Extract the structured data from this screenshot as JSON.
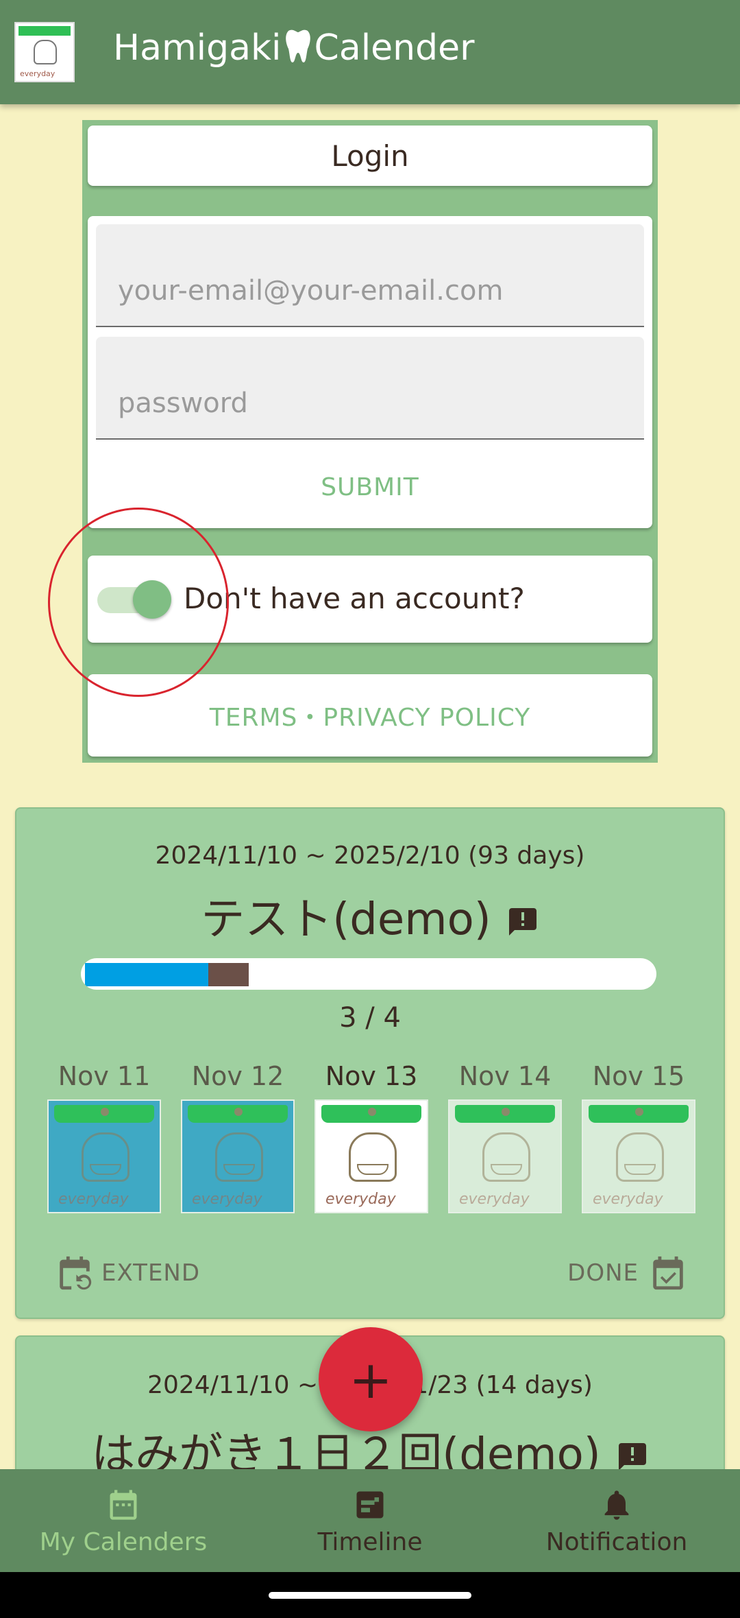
{
  "app": {
    "title_left": "Hamigaki",
    "title_right": "Calender",
    "logo_text": "everyday"
  },
  "login": {
    "title": "Login",
    "email_placeholder": "your-email@your-email.com",
    "password_placeholder": "password",
    "submit_label": "SUBMIT",
    "switch_label": "Don't have an account?",
    "switch_on": true,
    "terms_label": "TERMS・PRIVACY POLICY"
  },
  "calendars": [
    {
      "date_range": "2024/11/10 ~ 2025/2/10 (93 days)",
      "title": "テスト(demo)",
      "progress_text": "3 / 4",
      "progress": {
        "done": 3,
        "total": 4
      },
      "days": [
        {
          "label": "Nov 11",
          "state": "past"
        },
        {
          "label": "Nov 12",
          "state": "past"
        },
        {
          "label": "Nov 13",
          "state": "today"
        },
        {
          "label": "Nov 14",
          "state": "future"
        },
        {
          "label": "Nov 15",
          "state": "future"
        }
      ],
      "image_text": "everyday",
      "extend_label": "EXTEND",
      "done_label": "DONE"
    },
    {
      "date_range": "2024/11/10 ~ 2024/11/23 (14 days)",
      "title": "はみがき１日２回(demo)"
    }
  ],
  "fab": {
    "label": "+"
  },
  "nav": {
    "calendars": "My Calenders",
    "timeline": "Timeline",
    "notification": "Notification"
  },
  "colors": {
    "appbar": "#5f8a60",
    "background": "#f7f2c2",
    "card": "#9fd0a0",
    "accent": "#dc2a3b",
    "progress_done": "#009fe3",
    "progress_today": "#6b5048"
  }
}
